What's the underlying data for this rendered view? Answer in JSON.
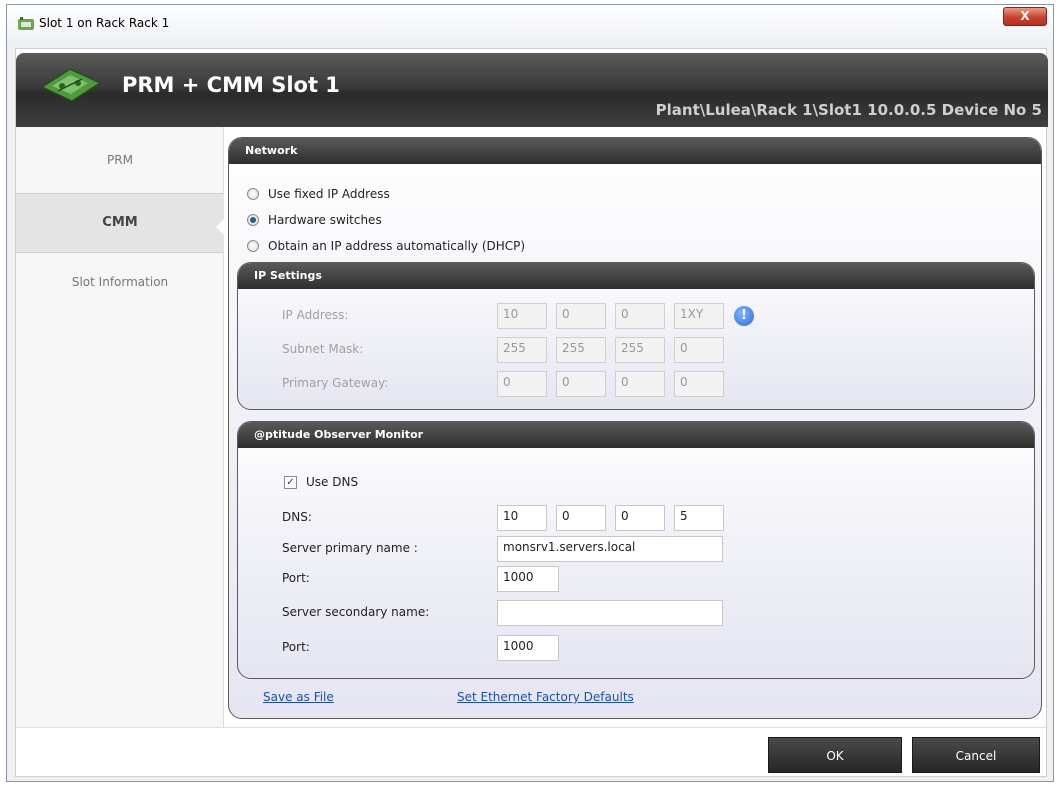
{
  "window": {
    "title": "Slot 1 on Rack Rack 1",
    "close_label": "X"
  },
  "header": {
    "title": "PRM + CMM Slot 1",
    "path": "Plant\\Lulea\\Rack 1\\Slot1 10.0.0.5 Device No 5"
  },
  "sidebar": {
    "items": [
      {
        "label": "PRM"
      },
      {
        "label": "CMM"
      },
      {
        "label": "Slot Information"
      }
    ]
  },
  "network": {
    "title": "Network",
    "options": [
      {
        "label": "Use fixed IP Address",
        "checked": false
      },
      {
        "label": "Hardware switches",
        "checked": true
      },
      {
        "label": "Obtain an IP address automatically (DHCP)",
        "checked": false
      }
    ]
  },
  "ip_settings": {
    "title": "IP Settings",
    "ip_address": {
      "label": "IP Address:",
      "octets": [
        "10",
        "0",
        "0",
        "1XY"
      ]
    },
    "subnet_mask": {
      "label": "Subnet Mask:",
      "octets": [
        "255",
        "255",
        "255",
        "0"
      ]
    },
    "gateway": {
      "label": "Primary Gateway:",
      "octets": [
        "0",
        "0",
        "0",
        "0"
      ]
    },
    "info_icon": "info-icon"
  },
  "monitor": {
    "title": "@ptitude Observer Monitor",
    "use_dns": {
      "label": "Use DNS",
      "checked": true
    },
    "dns": {
      "label": "DNS:",
      "octets": [
        "10",
        "0",
        "0",
        "5"
      ]
    },
    "server_primary": {
      "label": "Server primary name :",
      "value": "monsrv1.servers.local"
    },
    "port1": {
      "label": "Port:",
      "value": "1000"
    },
    "server_secondary": {
      "label": "Server secondary name:",
      "value": ""
    },
    "port2": {
      "label": "Port:",
      "value": "1000"
    }
  },
  "links": {
    "save": "Save as File",
    "defaults": "Set Ethernet Factory Defaults"
  },
  "buttons": {
    "ok": "OK",
    "cancel": "Cancel"
  }
}
